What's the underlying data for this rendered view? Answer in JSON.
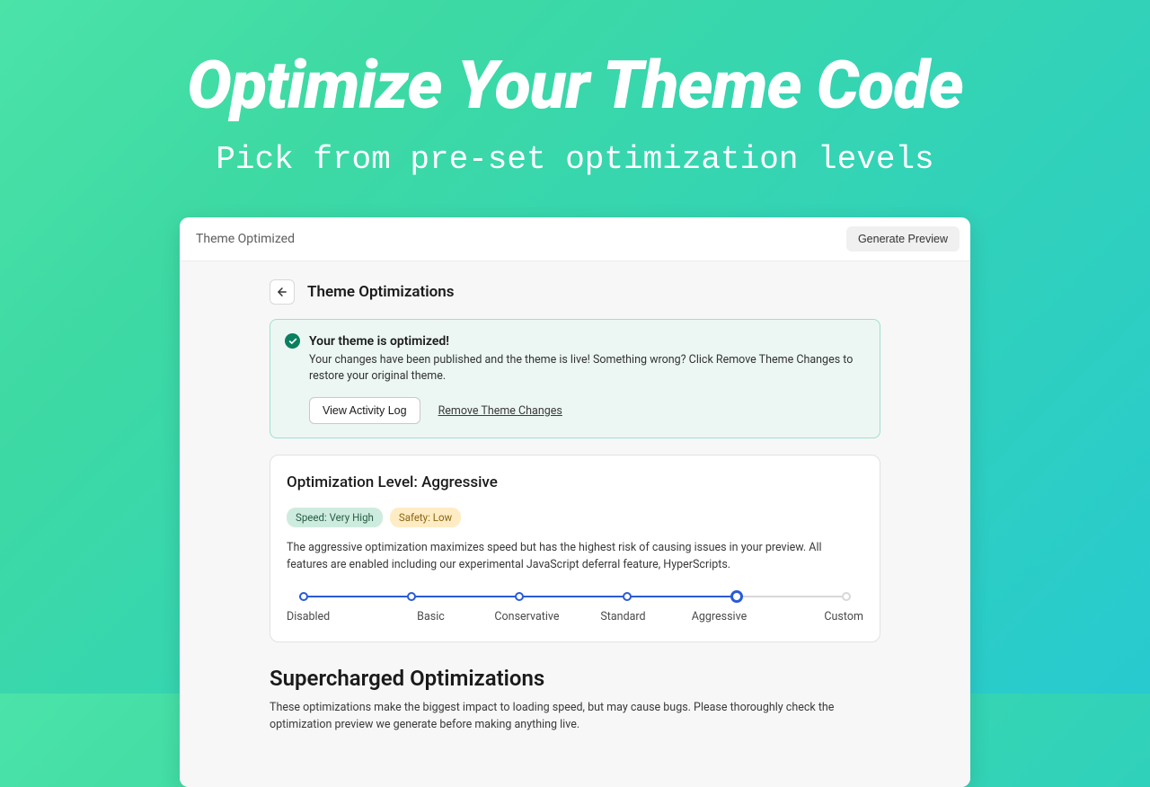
{
  "hero": {
    "title": "Optimize Your Theme Code",
    "subtitle": "Pick from pre-set optimization levels"
  },
  "header": {
    "app": "Theme Optimized",
    "generate": "Generate Preview"
  },
  "page": {
    "title": "Theme Optimizations"
  },
  "banner": {
    "title": "Your theme is optimized!",
    "body": "Your changes have been published and the theme is live! Something wrong? Click Remove Theme Changes to restore your original theme.",
    "view_log": "View Activity Log",
    "remove": "Remove Theme Changes"
  },
  "level": {
    "title": "Optimization Level: Aggressive",
    "badges": {
      "speed": "Speed: Very High",
      "safety": "Safety: Low"
    },
    "desc": "The aggressive optimization maximizes speed but has the highest risk of causing issues in your preview. All features are enabled including our experimental JavaScript deferral feature, HyperScripts.",
    "steps": [
      "Disabled",
      "Basic",
      "Conservative",
      "Standard",
      "Aggressive",
      "Custom"
    ],
    "selected_index": 4
  },
  "supercharged": {
    "title": "Supercharged Optimizations",
    "desc": "These optimizations make the biggest impact to loading speed, but may cause bugs. Please thoroughly check the optimization preview we generate before making anything live."
  }
}
